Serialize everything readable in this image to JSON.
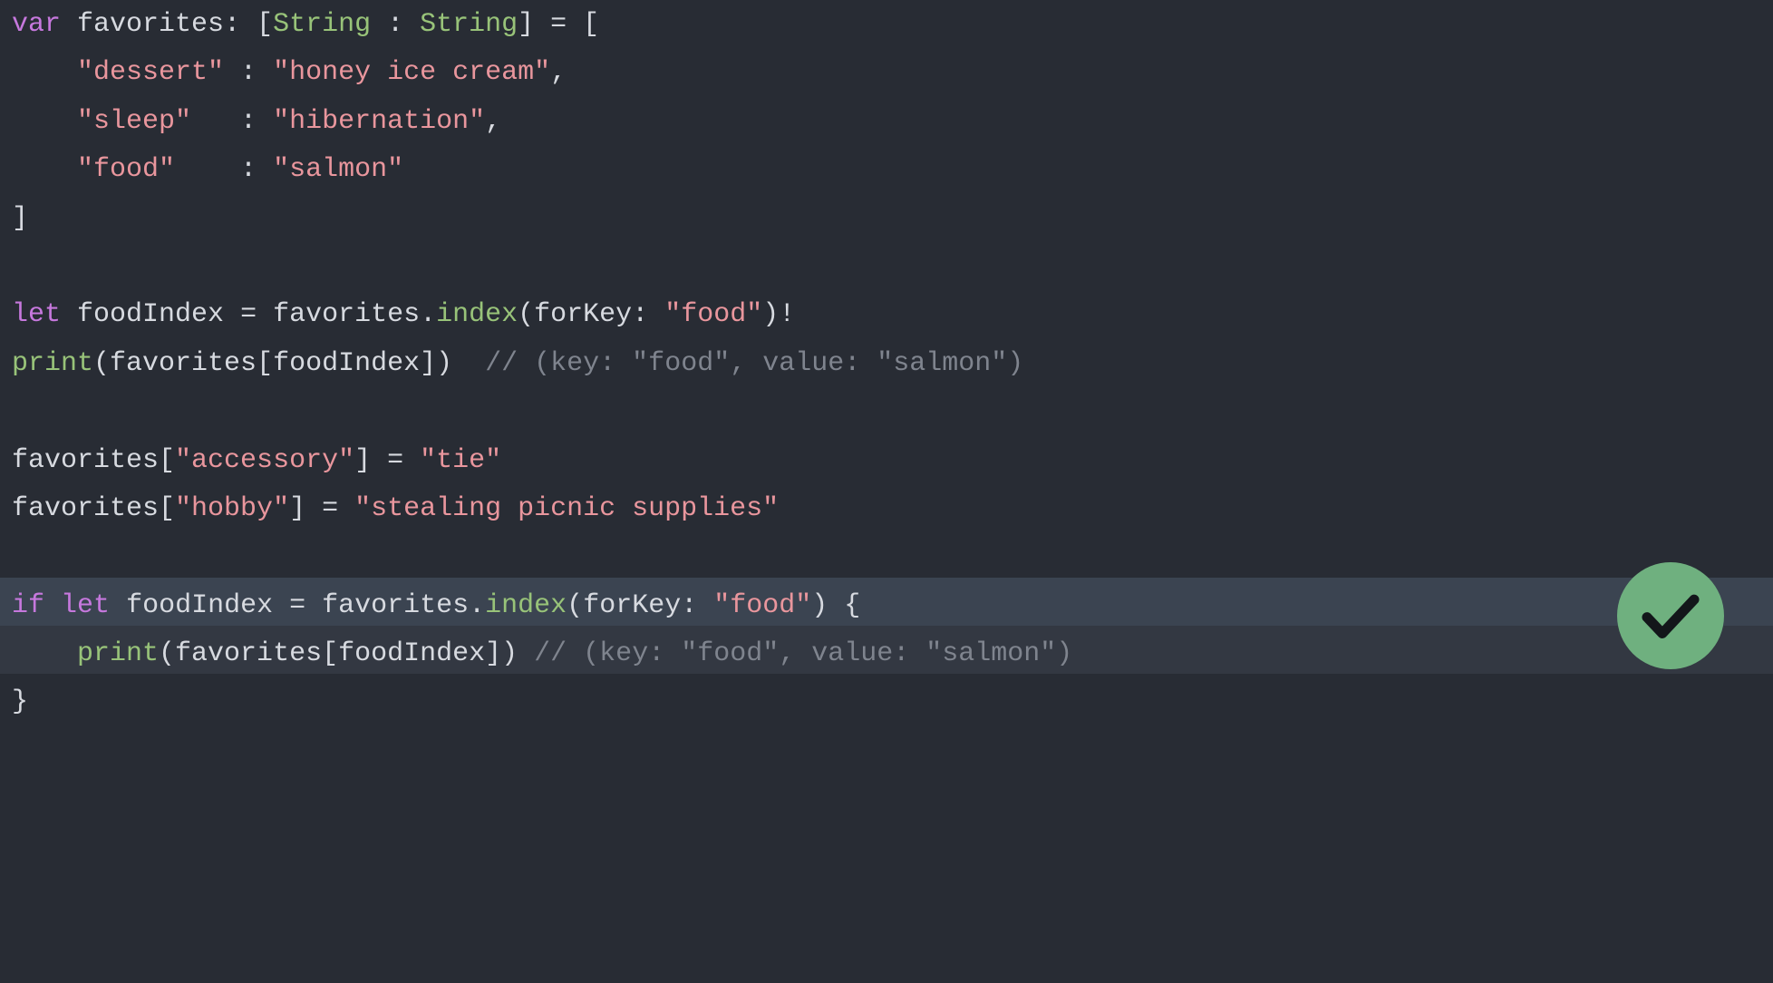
{
  "code": {
    "line1": {
      "kw_var": "var",
      "id": "favorites",
      "type1": "String",
      "type2": "String",
      "colon_sep": " : ",
      "open": " = ["
    },
    "entry1": {
      "indent": "    ",
      "key": "\"dessert\"",
      "sep": " : ",
      "val": "\"honey ice cream\"",
      "trail": ","
    },
    "entry2": {
      "indent": "    ",
      "key": "\"sleep\"",
      "sep": "   : ",
      "val": "\"hibernation\"",
      "trail": ","
    },
    "entry3": {
      "indent": "    ",
      "key": "\"food\"",
      "sep": "    : ",
      "val": "\"salmon\"",
      "trail": ""
    },
    "close_bracket": "]",
    "line_let": {
      "kw_let": "let",
      "id": "foodIndex",
      "eq": " = ",
      "obj": "favorites",
      "dot": ".",
      "fn": "index",
      "open": "(",
      "arglabel": "forKey",
      "argcolon": ": ",
      "argval": "\"food\"",
      "close": ")!"
    },
    "line_print1": {
      "fn": "print",
      "open": "(",
      "obj": "favorites",
      "sub_open": "[",
      "idx": "foodIndex",
      "sub_close": "]",
      "close": ")",
      "gap": "  ",
      "comment": "// (key: \"food\", value: \"salmon\")"
    },
    "assign1": {
      "obj": "favorites",
      "sub_open": "[",
      "key": "\"accessory\"",
      "sub_close": "]",
      "eq": " = ",
      "val": "\"tie\""
    },
    "assign2": {
      "obj": "favorites",
      "sub_open": "[",
      "key": "\"hobby\"",
      "sub_close": "]",
      "eq": " = ",
      "val": "\"stealing picnic supplies\""
    },
    "if_block": {
      "kw_if": "if",
      "kw_let": "let",
      "id": "foodIndex",
      "eq": " = ",
      "obj": "favorites",
      "dot": ".",
      "fn": "index",
      "open": "(",
      "arglabel": "forKey",
      "argcolon": ": ",
      "argval": "\"food\"",
      "close": ") {",
      "body_indent": "    ",
      "body_fn": "print",
      "body_open": "(",
      "body_obj": "favorites",
      "body_sub_open": "[",
      "body_idx": "foodIndex",
      "body_sub_close": "]",
      "body_close": ")",
      "body_gap": " ",
      "body_comment": "// (key: \"food\", value: \"salmon\")",
      "close_brace": "}"
    }
  },
  "badge": {
    "name": "success-check",
    "color": "#6fb07f",
    "stroke": "#13161a"
  }
}
